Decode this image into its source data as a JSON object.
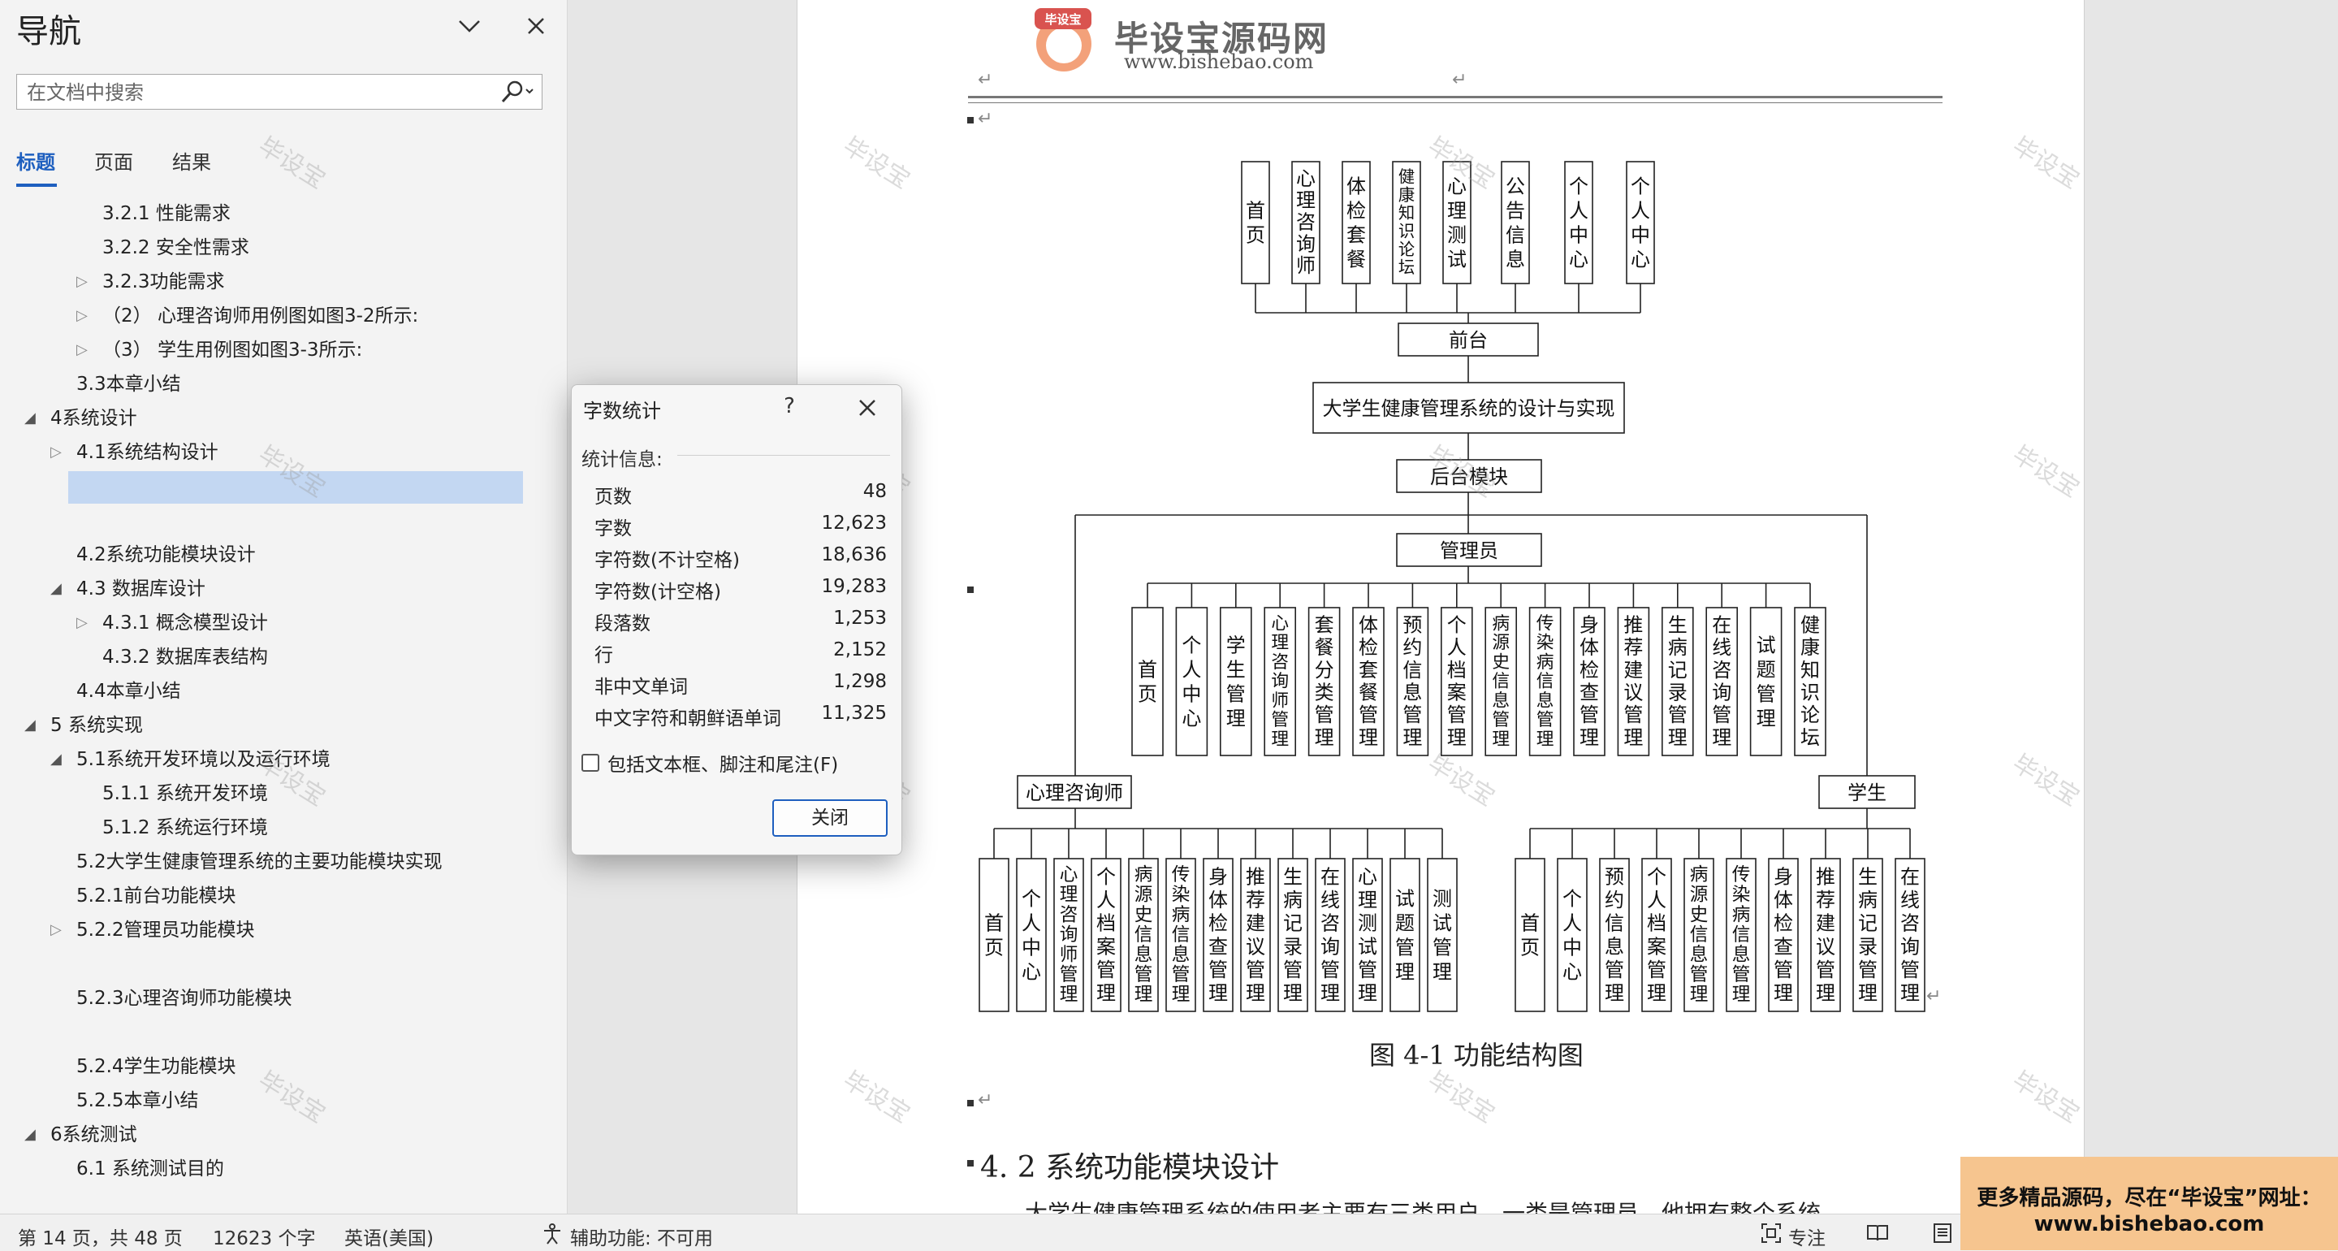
{
  "nav": {
    "title": "导航",
    "search_placeholder": "在文档中搜索",
    "tabs": [
      "标题",
      "页面",
      "结果"
    ],
    "outline": [
      "3.2.1 性能需求",
      "3.2.2 安全性需求",
      "3.2.3功能需求",
      "（2） 心理咨询师用例图如图3-2所示:",
      "（3） 学生用例图如图3-3所示:",
      "3.3本章小结",
      "4系统设计",
      "4.1系统结构设计",
      "4.2系统功能模块设计",
      "4.3 数据库设计",
      "4.3.1 概念模型设计",
      "4.3.2 数据库表结构",
      "4.4本章小结",
      "5 系统实现",
      "5.1系统开发环境以及运行环境",
      "5.1.1 系统开发环境",
      "5.1.2 系统运行环境",
      "5.2大学生健康管理系统的主要功能模块实现",
      "5.2.1前台功能模块",
      "5.2.2管理员功能模块",
      "5.2.3心理咨询师功能模块",
      "5.2.4学生功能模块",
      "5.2.5本章小结",
      "6系统测试",
      "6.1 系统测试目的"
    ]
  },
  "document": {
    "logo_text": "毕设宝源码网",
    "logo_badge": "毕设宝",
    "logo_url": "www.bishebao.com",
    "watermark": "毕设宝",
    "diagram": {
      "front_modules": [
        "首页",
        "心理咨询师",
        "体检套餐",
        "健康知识论坛",
        "心理测试",
        "公告信息",
        "个人中心",
        "个人中心"
      ],
      "front_label": "前台",
      "system_title": "大学生健康管理系统的设计与实现",
      "backend_label": "后台模块",
      "admin_label": "管理员",
      "admin_modules": [
        "首页",
        "个人中心",
        "学生管理",
        "心理咨询师管理",
        "套餐分类管理",
        "体检套餐管理",
        "预约信息管理",
        "个人档案管理",
        "病源史信息管理",
        "传染病信息管理",
        "身体检查管理",
        "推荐建议管理",
        "生病记录管理",
        "在线咨询管理",
        "试题管理",
        "健康知识论坛"
      ],
      "counselor_label": "心理咨询师",
      "counselor_modules": [
        "首页",
        "个人中心",
        "心理咨询师管理",
        "个人档案管理",
        "病源史信息管理",
        "传染病信息管理",
        "身体检查管理",
        "推荐建议管理",
        "生病记录管理",
        "在线咨询管理",
        "心理测试管理",
        "试题管理",
        "测试管理"
      ],
      "student_label": "学生",
      "student_modules": [
        "首页",
        "个人中心",
        "预约信息管理",
        "个人档案管理",
        "病源史信息管理",
        "传染病信息管理",
        "身体检查管理",
        "推荐建议管理",
        "生病记录管理",
        "在线咨询管理"
      ]
    },
    "figure_caption": "图 4-1 功能结构图",
    "section_heading": "4. 2 系统功能模块设计",
    "body_text": "大学生健康管理系统的使用者主要有三类用户，一类是管理员，他拥有整个系统"
  },
  "dialog": {
    "title": "字数统计",
    "help": "?",
    "section": "统计信息:",
    "stats": [
      {
        "label": "页数",
        "value": "48"
      },
      {
        "label": "字数",
        "value": "12,623"
      },
      {
        "label": "字符数(不计空格)",
        "value": "18,636"
      },
      {
        "label": "字符数(计空格)",
        "value": "19,283"
      },
      {
        "label": "段落数",
        "value": "1,253"
      },
      {
        "label": "行",
        "value": "2,152"
      },
      {
        "label": "非中文单词",
        "value": "1,298"
      },
      {
        "label": "中文字符和朝鲜语单词",
        "value": "11,325"
      }
    ],
    "checkbox_label": "包括文本框、脚注和尾注(F)",
    "close_label": "关闭"
  },
  "status": {
    "page_info": "第 14 页，共 48 页",
    "word_count": "12623 个字",
    "language": "英语(美国)",
    "accessibility": "辅助功能: 不可用",
    "focus": "专注"
  },
  "promo": {
    "line1": "更多精品源码，尽在“毕设宝”网址：",
    "line2": "www.bishebao.com"
  }
}
